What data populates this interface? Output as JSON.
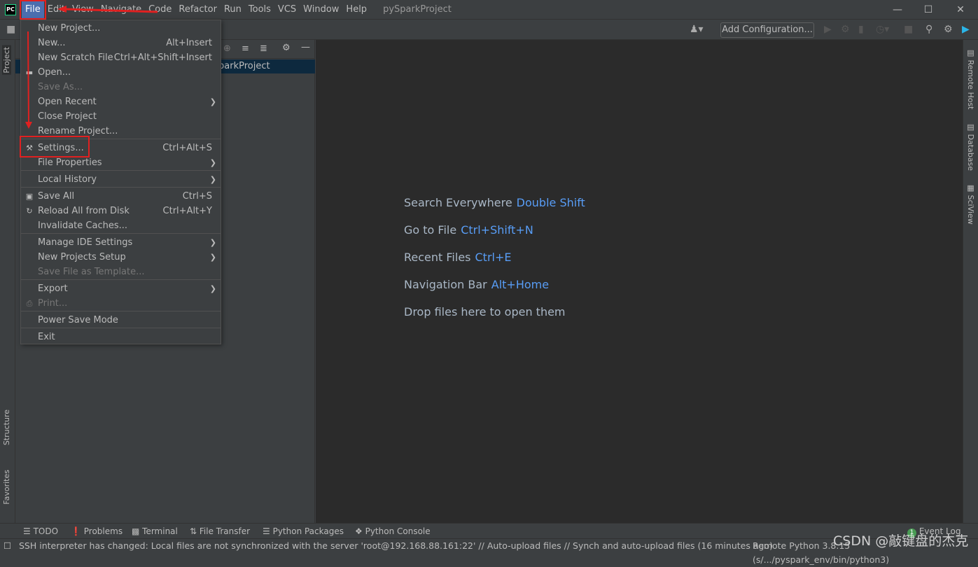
{
  "titlebar": {
    "logo": "PC",
    "menus": [
      "File",
      "Edit",
      "View",
      "Navigate",
      "Code",
      "Refactor",
      "Run",
      "Tools",
      "VCS",
      "Window",
      "Help"
    ],
    "title": "pySparkProject",
    "window_controls": [
      "minimize",
      "maximize",
      "close"
    ]
  },
  "toolbar": {
    "add_configuration": "Add Configuration...",
    "icons": [
      "user-icon",
      "run-icon",
      "debug-icon",
      "coverage-icon",
      "profile-icon",
      "stop-icon",
      "search-icon",
      "gear-icon",
      "toolbox-icon"
    ]
  },
  "left_strip": {
    "tabs": [
      "Project",
      "Structure",
      "Favorites"
    ]
  },
  "project_panel": {
    "selected_row": "pySparkProject",
    "visible_row_text": "parkProject"
  },
  "editor": {
    "hints": [
      {
        "label": "Search Everywhere",
        "key": "Double Shift"
      },
      {
        "label": "Go to File",
        "key": "Ctrl+Shift+N"
      },
      {
        "label": "Recent Files",
        "key": "Ctrl+E"
      },
      {
        "label": "Navigation Bar",
        "key": "Alt+Home"
      },
      {
        "label": "Drop files here to open them",
        "key": ""
      }
    ]
  },
  "right_strip": {
    "tabs": [
      "Remote Host",
      "Database",
      "SciView"
    ]
  },
  "file_menu": {
    "items": [
      {
        "label": "New Project...",
        "shortcut": "",
        "submenu": false,
        "disabled": false
      },
      {
        "label": "New...",
        "shortcut": "Alt+Insert",
        "submenu": false,
        "disabled": false
      },
      {
        "label": "New Scratch File",
        "shortcut": "Ctrl+Alt+Shift+Insert",
        "submenu": false,
        "disabled": false
      },
      {
        "label": "Open...",
        "shortcut": "",
        "submenu": false,
        "disabled": false,
        "icon": "folder-open-icon"
      },
      {
        "label": "Save As...",
        "shortcut": "",
        "submenu": false,
        "disabled": true
      },
      {
        "label": "Open Recent",
        "shortcut": "",
        "submenu": true,
        "disabled": false
      },
      {
        "label": "Close Project",
        "shortcut": "",
        "submenu": false,
        "disabled": false
      },
      {
        "label": "Rename Project...",
        "shortcut": "",
        "submenu": false,
        "disabled": false
      },
      {
        "label": "Settings...",
        "shortcut": "Ctrl+Alt+S",
        "submenu": false,
        "disabled": false,
        "icon": "wrench-icon"
      },
      {
        "label": "File Properties",
        "shortcut": "",
        "submenu": true,
        "disabled": false
      },
      {
        "label": "Local History",
        "shortcut": "",
        "submenu": true,
        "disabled": false
      },
      {
        "label": "Save All",
        "shortcut": "Ctrl+S",
        "submenu": false,
        "disabled": false,
        "icon": "save-icon"
      },
      {
        "label": "Reload All from Disk",
        "shortcut": "Ctrl+Alt+Y",
        "submenu": false,
        "disabled": false,
        "icon": "reload-icon"
      },
      {
        "label": "Invalidate Caches...",
        "shortcut": "",
        "submenu": false,
        "disabled": false
      },
      {
        "label": "Manage IDE Settings",
        "shortcut": "",
        "submenu": true,
        "disabled": false
      },
      {
        "label": "New Projects Setup",
        "shortcut": "",
        "submenu": true,
        "disabled": false
      },
      {
        "label": "Save File as Template...",
        "shortcut": "",
        "submenu": false,
        "disabled": true
      },
      {
        "label": "Export",
        "shortcut": "",
        "submenu": true,
        "disabled": false
      },
      {
        "label": "Print...",
        "shortcut": "",
        "submenu": false,
        "disabled": true,
        "icon": "print-icon"
      },
      {
        "label": "Power Save Mode",
        "shortcut": "",
        "submenu": false,
        "disabled": false
      },
      {
        "label": "Exit",
        "shortcut": "",
        "submenu": false,
        "disabled": false
      }
    ]
  },
  "tool_windows": [
    "TODO",
    "Problems",
    "Terminal",
    "File Transfer",
    "Python Packages",
    "Python Console"
  ],
  "event_log": {
    "label": "Event Log",
    "count": "1"
  },
  "status": {
    "message": "SSH interpreter has changed: Local files are not synchronized with the server 'root@192.168.88.161:22' // Auto-upload files // Synch and auto-upload files (16 minutes ago)",
    "interpreter": "Remote Python 3.8.15 (s/.../pyspark_env/bin/python3)"
  },
  "watermark": "CSDN @敲键盘的杰克",
  "colors": {
    "accent": "#4b6eaf",
    "key_hint": "#589df6",
    "annotation": "#e02020"
  }
}
